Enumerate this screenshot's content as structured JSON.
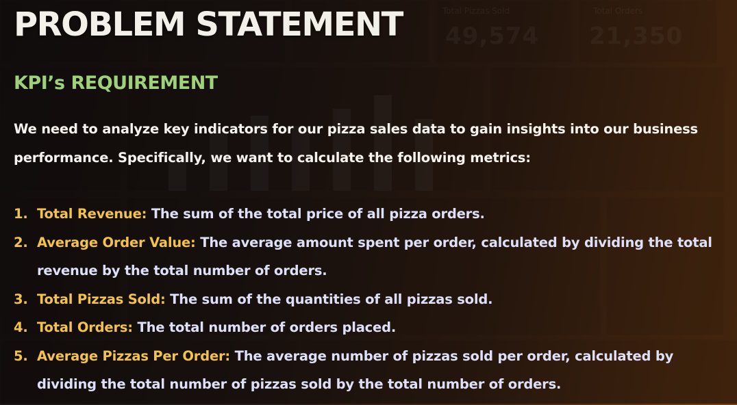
{
  "slide": {
    "title": "PROBLEM STATEMENT",
    "subtitle": "KPI’s REQUIREMENT",
    "intro": "We need to analyze key indicators for our pizza sales data to gain insights into our business performance. Specifically, we want to calculate the following metrics:",
    "metrics": [
      {
        "number": "1.",
        "term": "Total Revenue:",
        "description": " The sum of the total price of all pizza orders."
      },
      {
        "number": "2.",
        "term": "Average Order Value:",
        "description": " The average amount spent per order, calculated by dividing the total revenue by the total number of orders."
      },
      {
        "number": "3.",
        "term": "Total Pizzas Sold:",
        "description": " The sum of the quantities of all pizzas sold."
      },
      {
        "number": "4.",
        "term": "Total Orders:",
        "description": " The total number of orders placed."
      },
      {
        "number": "5.",
        "term": "Average Pizzas Per Order:",
        "description": " The average number of pizzas sold per order, calculated by dividing the total number of pizzas sold by the total number of orders."
      }
    ]
  },
  "background": {
    "kpi_labels": [
      "Total Pizzas Sold",
      "Total Orders"
    ],
    "kpi_values": [
      "49,574",
      "21,350"
    ]
  },
  "colors": {
    "title": "#f3f0ea",
    "subtitle": "#9fd07a",
    "intro_text": "#f6f3ee",
    "metric_term": "#f3c24a",
    "metric_description": "#dde0f6"
  }
}
